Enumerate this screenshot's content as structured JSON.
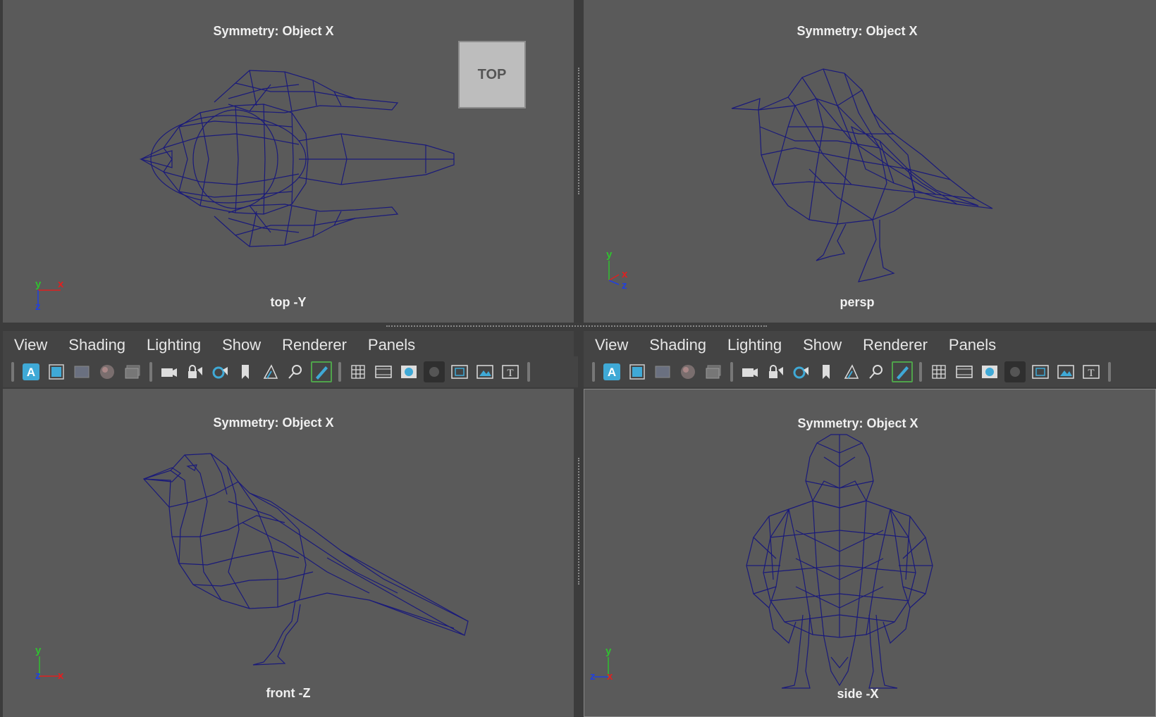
{
  "viewports": {
    "top": {
      "symmetry": "Symmetry: Object X",
      "camera": "top -Y",
      "viewcube": "TOP"
    },
    "persp": {
      "symmetry": "Symmetry: Object X",
      "camera": "persp"
    },
    "front": {
      "symmetry": "Symmetry: Object X",
      "camera": "front -Z"
    },
    "side": {
      "symmetry": "Symmetry: Object X",
      "camera": "side -X"
    }
  },
  "menus": {
    "left": [
      "View",
      "Shading",
      "Lighting",
      "Show",
      "Renderer",
      "Panels"
    ],
    "right": [
      "View",
      "Shading",
      "Lighting",
      "Show",
      "Renderer",
      "Panels"
    ]
  },
  "axes": {
    "x": "x",
    "y": "y",
    "z": "z"
  },
  "colors": {
    "wire": "#1a1a7a",
    "viewport_bg": "#5a5a5a",
    "axis_x": "#e02020",
    "axis_y": "#30c030",
    "axis_z": "#2040e0",
    "accent": "#3fa9d6"
  },
  "toolbar_icons": [
    "sep",
    "select-camera-A-icon",
    "frame-icon",
    "grid-toggle-icon",
    "shading-ball-icon",
    "image-plane-icon",
    "sep",
    "camera-icon",
    "lock-camera-icon",
    "camera-attributes-icon",
    "bookmark-icon",
    "2d-pan-zoom-icon",
    "zoom-icon",
    "grease-pencil-icon",
    "sep",
    "grid-icon",
    "film-gate-icon",
    "resolution-gate-icon",
    "gate-mask-icon",
    "field-chart-icon",
    "safe-action-icon",
    "safe-title-icon",
    "sep"
  ]
}
